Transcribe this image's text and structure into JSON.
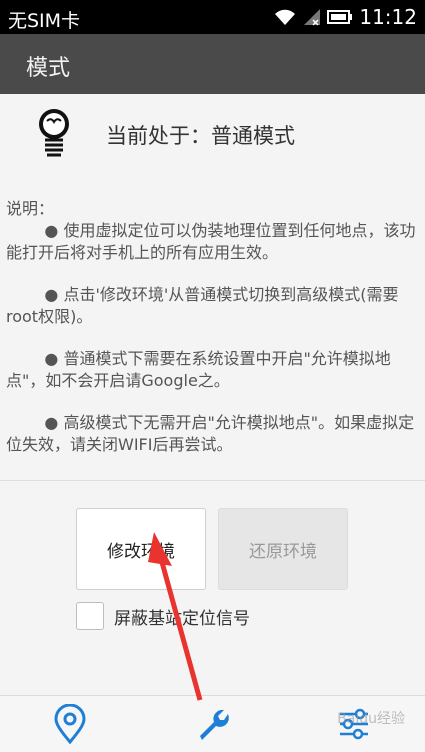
{
  "status_bar": {
    "carrier": "无SIM卡",
    "time": "11:12",
    "icons": [
      "wifi-icon",
      "signal-icon",
      "battery-icon"
    ]
  },
  "app_bar": {
    "title": "模式"
  },
  "mode": {
    "icon": "lightbulb-icon",
    "text": "当前处于：普通模式"
  },
  "description": {
    "heading": "说明：",
    "bullets": [
      "● 使用虚拟定位可以伪装地理位置到任何地点，该功能打开后将对手机上的所有应用生效。",
      "● 点击'修改环境'从普通模式切换到高级模式(需要root权限)。",
      "● 普通模式下需要在系统设置中开启\"允许模拟地点\"，如不会开启请Google之。",
      "● 高级模式下无需开启\"允许模拟地点\"。如果虚拟定位失效，请关闭WIFI后再尝试。"
    ]
  },
  "buttons": {
    "modify": "修改环境",
    "restore": "还原环境"
  },
  "checkbox": {
    "label": "屏蔽基站定位信号"
  },
  "bottom_nav": {
    "items": [
      "location-icon",
      "wrench-icon",
      "settings-sliders-icon"
    ]
  },
  "watermark": "Baidu经验",
  "colors": {
    "app_bar": "#4a4a4a",
    "status_bar": "#000000",
    "accent_blue": "#1e7fd6",
    "arrow_red": "#e8332f"
  }
}
